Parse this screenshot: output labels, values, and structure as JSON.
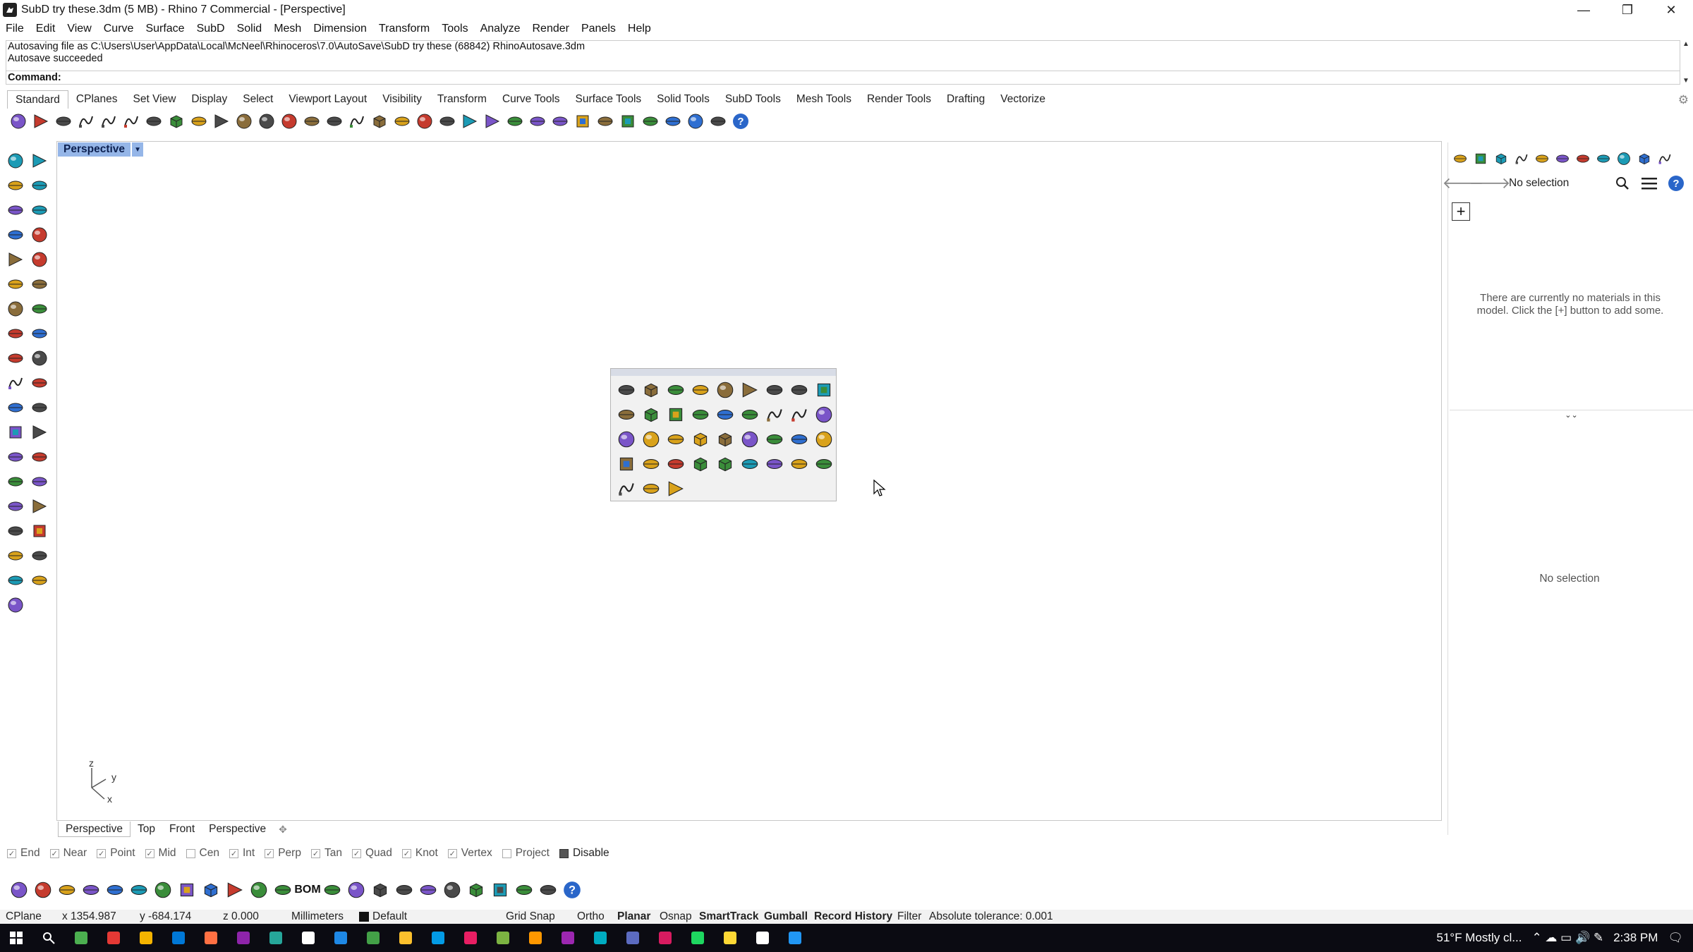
{
  "window": {
    "title": "SubD try these.3dm (5 MB) - Rhino 7 Commercial - [Perspective]",
    "minimize_glyph": "—",
    "maximize_glyph": "❐",
    "close_glyph": "✕"
  },
  "menu": [
    "File",
    "Edit",
    "View",
    "Curve",
    "Surface",
    "SubD",
    "Solid",
    "Mesh",
    "Dimension",
    "Transform",
    "Tools",
    "Analyze",
    "Render",
    "Panels",
    "Help"
  ],
  "command_history": [
    "Autosaving file as C:\\Users\\User\\AppData\\Local\\McNeel\\Rhinoceros\\7.0\\AutoSave\\SubD try these (68842) RhinoAutosave.3dm",
    "Autosave succeeded"
  ],
  "command_prompt": "Command:",
  "toolbar_tabs": [
    "Standard",
    "CPlanes",
    "Set View",
    "Display",
    "Select",
    "Viewport Layout",
    "Visibility",
    "Transform",
    "Curve Tools",
    "Surface Tools",
    "Solid Tools",
    "SubD Tools",
    "Mesh Tools",
    "Render Tools",
    "Drafting",
    "Vectorize"
  ],
  "active_toolbar_tab": "Standard",
  "standard_tools": [
    "new-file-icon",
    "open-icon",
    "save-icon",
    "print-icon",
    "import-icon",
    "cut-icon",
    "copy-icon",
    "paste-icon",
    "undo-icon",
    "pan-icon",
    "rotate-view-icon",
    "zoom-dynamic-icon",
    "zoom-window-icon",
    "zoom-extents-icon",
    "zoom-selected-icon",
    "rotate-icon",
    "four-views-icon",
    "car-icon",
    "hide-icon",
    "show-icon",
    "object-snap-icon",
    "bulb-icon",
    "lock-icon",
    "layer-icon",
    "color-wheel-icon",
    "render-sphere-icon",
    "material-icon",
    "environment-icon",
    "properties-icon",
    "options-icon",
    "grid-icon",
    "globe-icon",
    "help-icon"
  ],
  "left_tools": [
    [
      "select-arrow-icon",
      "point-icon"
    ],
    [
      "line-icon",
      "polyline-icon"
    ],
    [
      "curve-cv-icon",
      "circle-icon"
    ],
    [
      "ellipse-icon",
      "polygon-icon"
    ],
    [
      "rectangle-icon",
      "arc-icon"
    ],
    [
      "fillet-curve-icon",
      "surface-from-curves-icon"
    ],
    [
      "extrude-curve-icon",
      "box-icon"
    ],
    [
      "boolean-union-icon",
      "cylinder-icon"
    ],
    [
      "surface-edit-icon",
      "gear-tools-icon"
    ],
    [
      "loft-icon",
      "split-icon"
    ],
    [
      "dimension-icon",
      "mesh-icon"
    ],
    [
      "move-icon",
      "offset-curve-icon"
    ],
    [
      "blend-icon",
      "extend-icon"
    ],
    [
      "control-points-icon",
      "array-icon"
    ],
    [
      "explode-icon",
      "group-icon"
    ],
    [
      "distance-icon",
      "grid-array-icon"
    ],
    [
      "history-icon",
      "text-icon"
    ],
    [
      "check-icon",
      "analyze-icon"
    ],
    [
      "paint-bucket-icon"
    ]
  ],
  "viewport": {
    "name": "Perspective",
    "axis_x": "x",
    "axis_y": "y",
    "axis_z": "z"
  },
  "popup_tools": [
    "sphere-icon",
    "gear-icon",
    "flame-icon",
    "vertex-icon",
    "curve-icon",
    "dash-line-icon",
    "spring-icon",
    "cube-face-icon",
    "patch-icon",
    "twist-icon",
    "arc-1-2-icon",
    "arc-tool-icon",
    "cone-icon",
    "funnel-icon",
    "ellipsoid-icon",
    "sphere-group-icon",
    "sphere-pair-icon",
    "box-solid-icon",
    "box-solid2-icon",
    "cylinder-solid-icon",
    "cylinder-disk-icon",
    "plane-icon",
    "surface-twist-icon",
    "surface-flat-icon",
    "cube-color-icon",
    "ruler-icon",
    "sweep-icon",
    "explode-solid-icon",
    "cage-icon",
    "ladder-icon",
    "segment-icon",
    "curve-path-icon",
    "drape-icon",
    "moon-icon",
    "wedge-icon",
    "hook-icon",
    "torus-icon",
    "sphere-mix-icon",
    "ball-set-icon"
  ],
  "viewport_tabs": [
    "Perspective",
    "Top",
    "Front",
    "Perspective"
  ],
  "active_viewport_tab": "Perspective",
  "osnaps": [
    {
      "label": "End",
      "checked": true
    },
    {
      "label": "Near",
      "checked": true
    },
    {
      "label": "Point",
      "checked": true
    },
    {
      "label": "Mid",
      "checked": true
    },
    {
      "label": "Cen",
      "checked": false
    },
    {
      "label": "Int",
      "checked": true
    },
    {
      "label": "Perp",
      "checked": true
    },
    {
      "label": "Tan",
      "checked": true
    },
    {
      "label": "Quad",
      "checked": true
    },
    {
      "label": "Knot",
      "checked": true
    },
    {
      "label": "Vertex",
      "checked": true
    },
    {
      "label": "Project",
      "checked": false
    },
    {
      "label": "Disable",
      "checked": true
    }
  ],
  "bottom_tools": [
    "move-ucs-icon",
    "snap-icon",
    "transform-icon",
    "cplane-icon",
    "flow-icon",
    "warp-icon",
    "cage-edit-icon",
    "red-cube-icon",
    "twist-tool-icon",
    "display-icon",
    "plane-edit-icon",
    "sum-icon",
    "bom-icon",
    "texture-icon",
    "cube-3d-icon",
    "section-icon",
    "align-icon",
    "distribute-icon",
    "camera-icon",
    "sync-icon",
    "search-zoom-icon",
    "settings-icon",
    "decal-icon",
    "help-icon"
  ],
  "bom_label": "BOM",
  "status": {
    "cplane": "CPlane",
    "x": "x 1354.987",
    "y": "y -684.174",
    "z": "z 0.000",
    "units": "Millimeters",
    "layer": "Default",
    "grid_snap": "Grid Snap",
    "ortho": "Ortho",
    "planar": "Planar",
    "osnap": "Osnap",
    "smarttrack": "SmartTrack",
    "gumball": "Gumball",
    "record_history": "Record History",
    "filter": "Filter",
    "tolerance": "Absolute tolerance: 0.001"
  },
  "right_panel": {
    "selection": "No selection",
    "add_button": "+",
    "empty_message": "There are currently no materials in this model. Click the [+] button to add some.",
    "bottom_selection": "No selection",
    "tab_icons": [
      "materials-icon",
      "environment-icon",
      "textures-icon",
      "checker-icon",
      "sun-icon",
      "displays-icon",
      "layers-icon",
      "search-icon",
      "wand-icon",
      "folder-icon",
      "libraries-icon"
    ]
  },
  "taskbar": {
    "weather": "51°F  Mostly cl...",
    "time": "2:38 PM"
  }
}
